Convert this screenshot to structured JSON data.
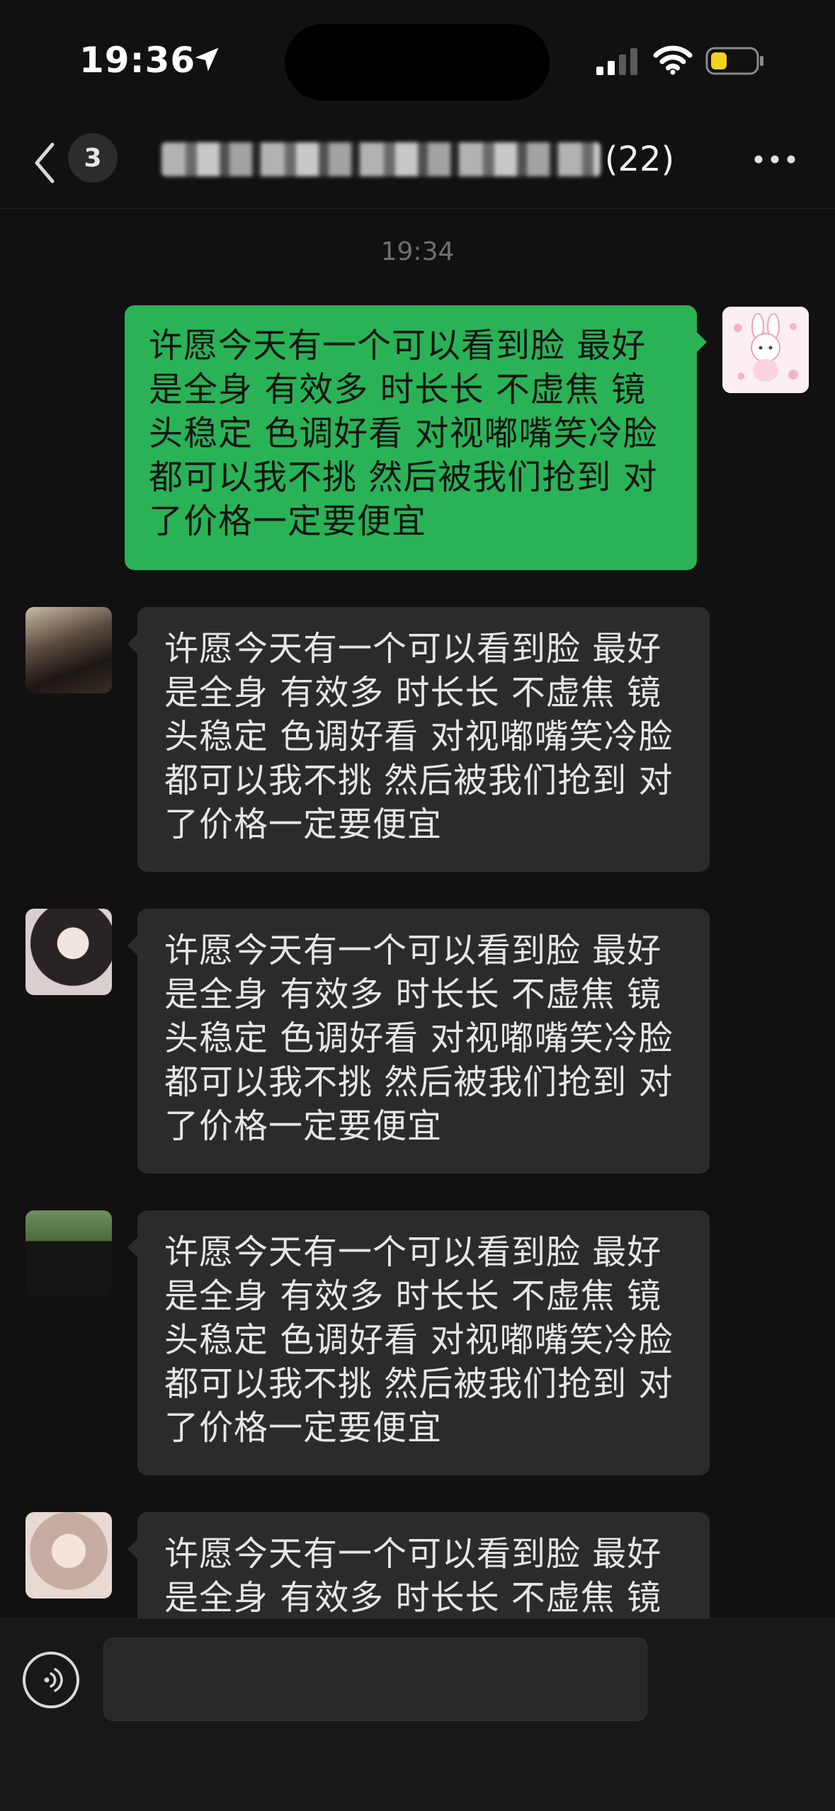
{
  "status_bar": {
    "time": "19:36"
  },
  "nav": {
    "unread_count": "3",
    "member_count": "(22)"
  },
  "chat": {
    "timestamp": "19:34",
    "messages": [
      {
        "sender": "me",
        "text": "许愿今天有一个可以看到脸 最好是全身 有效多 时长长 不虚焦 镜头稳定 色调好看 对视嘟嘴笑冷脸都可以我不挑 然后被我们抢到 对了价格一定要便宜"
      },
      {
        "sender": "member",
        "text": "许愿今天有一个可以看到脸 最好是全身 有效多 时长长 不虚焦 镜头稳定 色调好看 对视嘟嘴笑冷脸都可以我不挑 然后被我们抢到 对了价格一定要便宜"
      },
      {
        "sender": "member",
        "text": "许愿今天有一个可以看到脸 最好是全身 有效多 时长长 不虚焦 镜头稳定 色调好看 对视嘟嘴笑冷脸都可以我不挑 然后被我们抢到 对了价格一定要便宜"
      },
      {
        "sender": "member",
        "text": "许愿今天有一个可以看到脸 最好是全身 有效多 时长长 不虚焦 镜头稳定 色调好看 对视嘟嘴笑冷脸都可以我不挑 然后被我们抢到 对了价格一定要便宜"
      },
      {
        "sender": "member",
        "text": "许愿今天有一个可以看到脸 最好是全身 有效多 时长长 不虚焦 镜头稳定 色调好看 对视嘟嘴笑冷脸都可以我不挑 然后被我们抢到 对了价格一定要便宜"
      }
    ]
  },
  "icons": {
    "location": "location-arrow-icon",
    "signal": "cellular-signal-icon",
    "wifi": "wifi-icon",
    "battery": "battery-icon",
    "back": "chevron-left-icon",
    "more": "more-dots-icon",
    "voice": "voice-icon"
  },
  "colors": {
    "background": "#111111",
    "outgoing_bubble": "#29b356",
    "incoming_bubble": "#2b2b2b",
    "battery_level": "#f5d31c"
  }
}
